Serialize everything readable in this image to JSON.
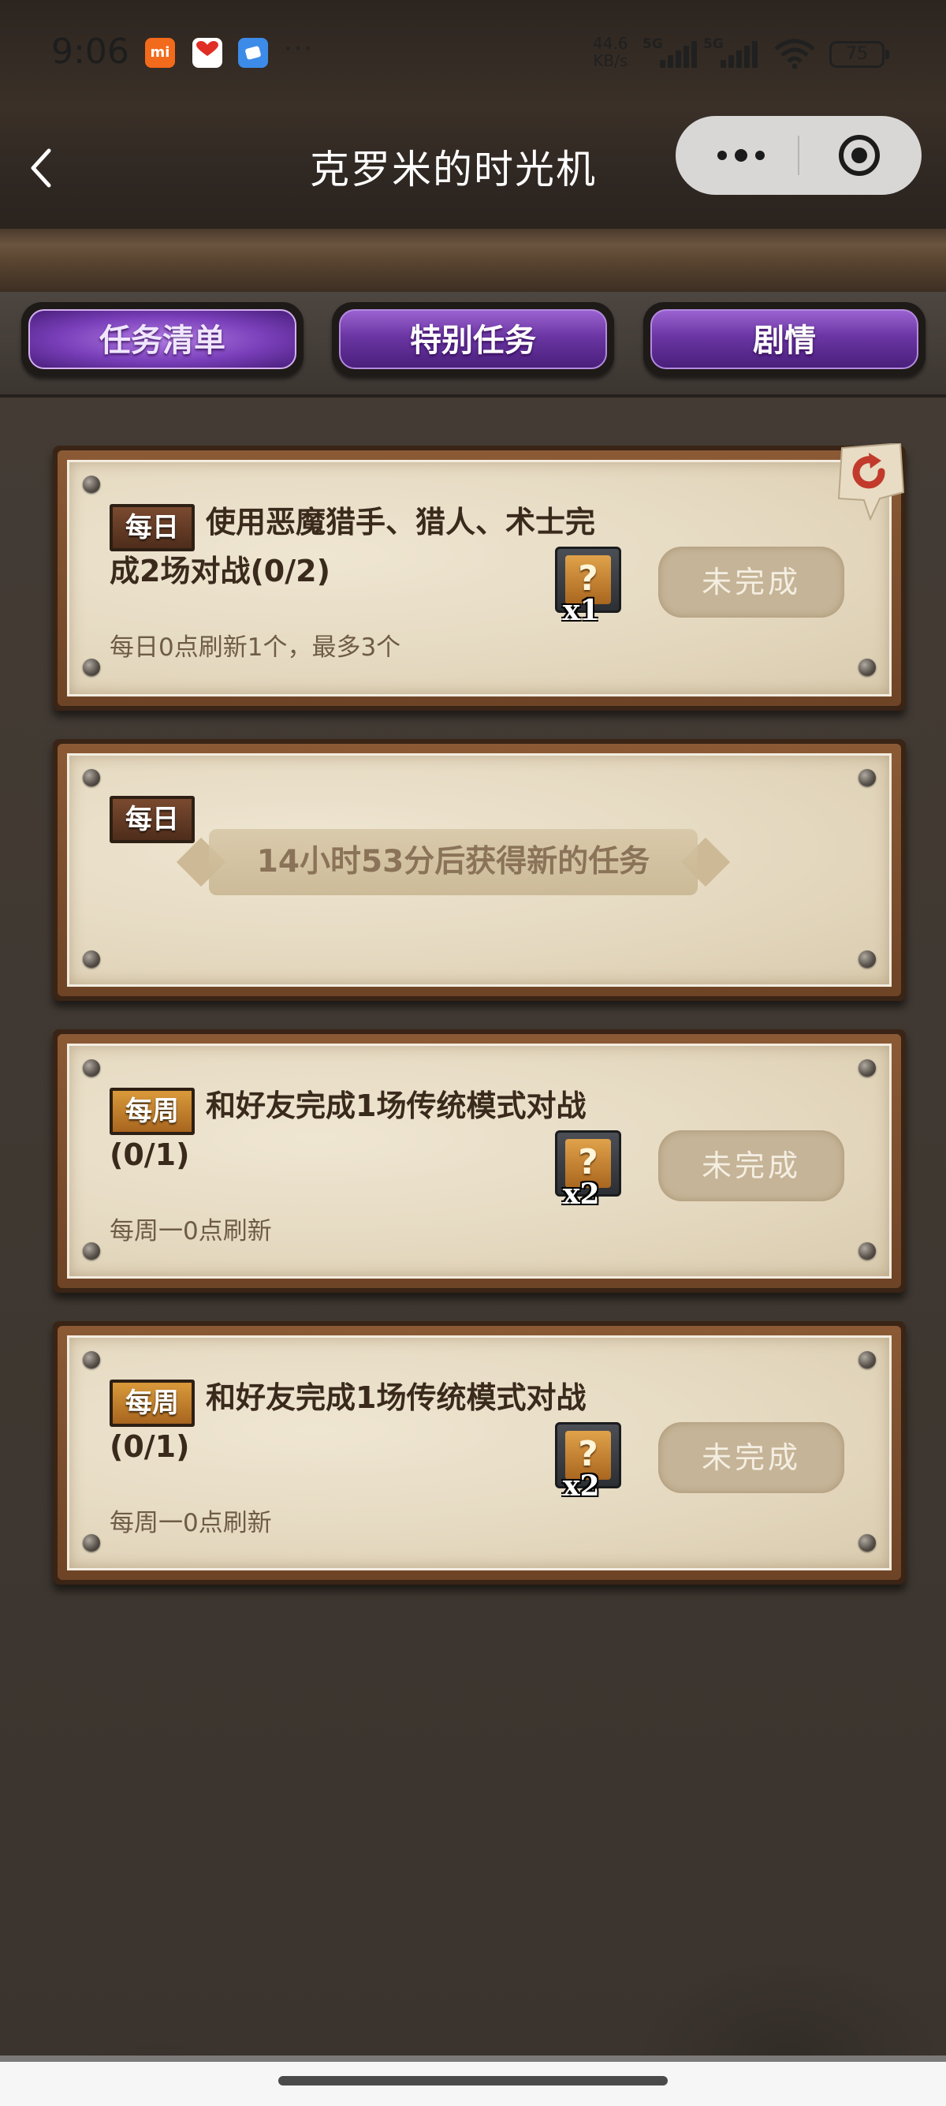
{
  "status_bar": {
    "time": "9:06",
    "apps": [
      {
        "name": "mi-app-icon",
        "label": "mi",
        "color": "#f26a1b"
      },
      {
        "name": "pdd-app-icon",
        "label": "拼多多",
        "color": "#e02e24"
      },
      {
        "name": "bluesky-app-icon",
        "label": "",
        "color": "#3d8be8"
      }
    ],
    "more": "···",
    "net_speed_value": "44.6",
    "net_speed_unit": "KB/s",
    "signal1_tag": "5G",
    "signal2_tag": "5G",
    "battery": "75"
  },
  "header": {
    "title": "克罗米的时光机"
  },
  "tabs": [
    {
      "label": "任务清单",
      "active": true
    },
    {
      "label": "特别任务",
      "active": false
    },
    {
      "label": "剧情",
      "active": false
    }
  ],
  "tasks": [
    {
      "type": "daily",
      "badge": "每日",
      "text": "使用恶魔猎手、猎人、术士完成2场对战(0/2)",
      "note": "每日0点刷新1个，最多3个",
      "reward_qty": "x1",
      "status": "未完成"
    },
    {
      "type": "daily-empty",
      "badge": "每日",
      "countdown": "14小时53分后获得新的任务"
    },
    {
      "type": "weekly",
      "badge": "每周",
      "text": "和好友完成1场传统模式对战(0/1)",
      "note": "每周一0点刷新",
      "reward_qty": "x2",
      "status": "未完成"
    },
    {
      "type": "weekly",
      "badge": "每周",
      "text": "和好友完成1场传统模式对战(0/1)",
      "note": "每周一0点刷新",
      "reward_qty": "x2",
      "status": "未完成"
    }
  ],
  "colors": {
    "tab_purple": "#7a3fba",
    "paper": "#e4d8bf",
    "daily_badge": "#5e3823",
    "weekly_badge": "#c07f2c"
  }
}
